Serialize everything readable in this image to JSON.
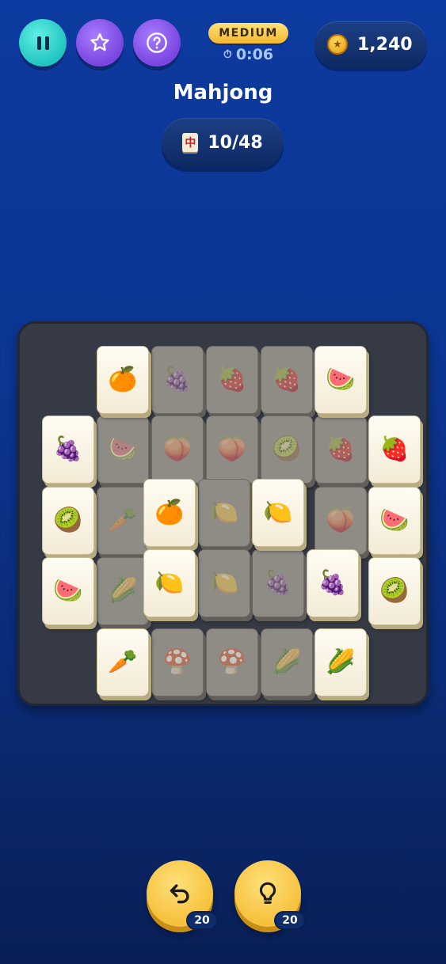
{
  "header": {
    "pause_icon": "pause-icon",
    "star_icon": "star-icon",
    "help_icon": "help-icon",
    "difficulty": "MEDIUM",
    "timer": "0:06",
    "timer_icon": "stopwatch-icon",
    "coins": "1,240",
    "coin_icon": "coin-icon"
  },
  "title": "Mahjong",
  "progress": {
    "icon_glyph": "中",
    "text": "10/48"
  },
  "tiles": [
    {
      "glyph": "🍊",
      "name": "orange",
      "state": "free"
    },
    {
      "glyph": "🍇",
      "name": "grapes",
      "state": "blocked"
    },
    {
      "glyph": "🍓",
      "name": "strawberry",
      "state": "blocked"
    },
    {
      "glyph": "🍓",
      "name": "strawberry",
      "state": "blocked"
    },
    {
      "glyph": "🍉",
      "name": "watermelon",
      "state": "free"
    },
    {
      "glyph": "🍇",
      "name": "grapes",
      "state": "free"
    },
    {
      "glyph": "🍉",
      "name": "watermelon",
      "state": "blocked"
    },
    {
      "glyph": "🍑",
      "name": "peach",
      "state": "blocked"
    },
    {
      "glyph": "🍑",
      "name": "peach",
      "state": "blocked"
    },
    {
      "glyph": "🥝",
      "name": "kiwi",
      "state": "blocked"
    },
    {
      "glyph": "🍓",
      "name": "strawberry",
      "state": "blocked"
    },
    {
      "glyph": "🍓",
      "name": "strawberry",
      "state": "free"
    },
    {
      "glyph": "🥝",
      "name": "kiwi",
      "state": "free"
    },
    {
      "glyph": "🥕",
      "name": "carrot",
      "state": "blocked"
    },
    {
      "glyph": "🍊",
      "name": "orange",
      "state": "free"
    },
    {
      "glyph": "🍋",
      "name": "lemon",
      "state": "blocked"
    },
    {
      "glyph": "🍋",
      "name": "lemon",
      "state": "free"
    },
    {
      "glyph": "🍑",
      "name": "peach",
      "state": "blocked"
    },
    {
      "glyph": "🍉",
      "name": "watermelon",
      "state": "free"
    },
    {
      "glyph": "🍉",
      "name": "watermelon",
      "state": "free"
    },
    {
      "glyph": "🌽",
      "name": "corn",
      "state": "blocked"
    },
    {
      "glyph": "🍋",
      "name": "lemon",
      "state": "free"
    },
    {
      "glyph": "🍋",
      "name": "lemon",
      "state": "blocked"
    },
    {
      "glyph": "🍇",
      "name": "grapes",
      "state": "blocked"
    },
    {
      "glyph": "🍇",
      "name": "grapes",
      "state": "free"
    },
    {
      "glyph": "🥝",
      "name": "kiwi",
      "state": "free"
    },
    {
      "glyph": "🥕",
      "name": "carrot",
      "state": "free"
    },
    {
      "glyph": "🍄",
      "name": "mushroom",
      "state": "blocked"
    },
    {
      "glyph": "🍄",
      "name": "mushroom",
      "state": "blocked"
    },
    {
      "glyph": "🌽",
      "name": "corn",
      "state": "blocked"
    },
    {
      "glyph": "🌽",
      "name": "corn",
      "state": "free"
    }
  ],
  "actions": {
    "undo_icon": "undo-icon",
    "undo_count": "20",
    "hint_icon": "lightbulb-icon",
    "hint_count": "20"
  }
}
